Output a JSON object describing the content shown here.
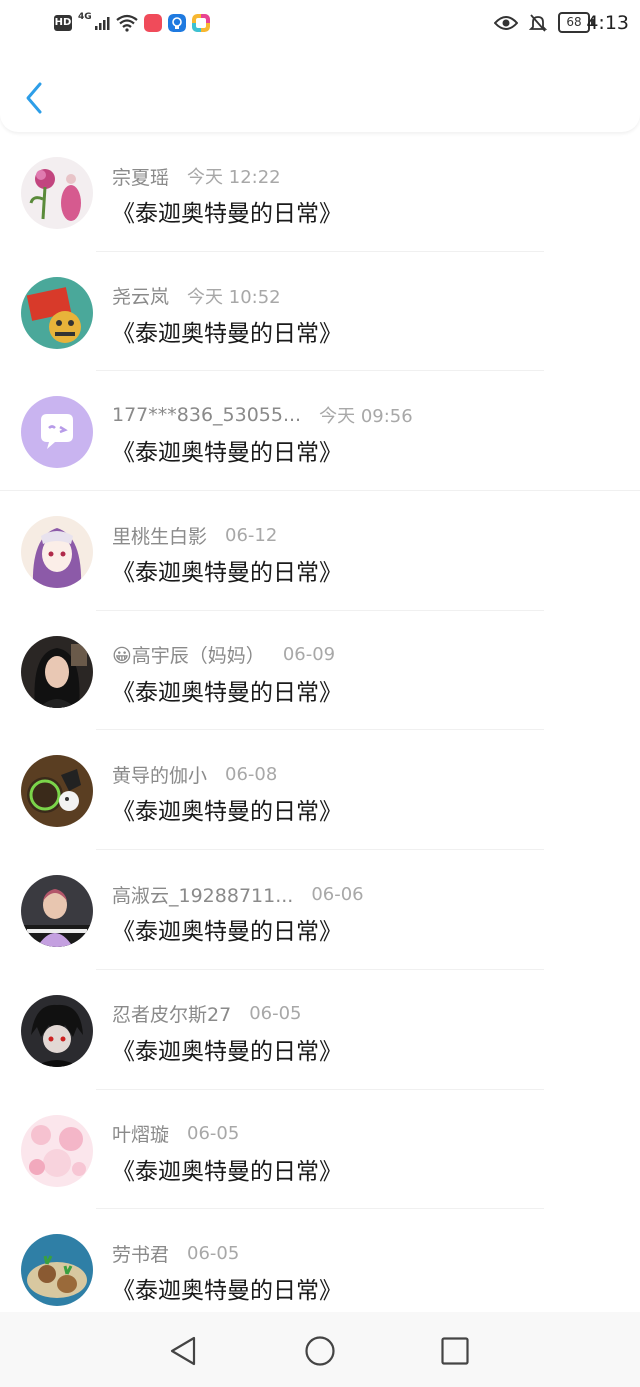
{
  "status_bar": {
    "network_type": "4G",
    "hd_label": "HD",
    "battery": "68",
    "time": "4:13"
  },
  "nav": {
    "back_icon": "chevron-left-icon",
    "accent_color": "#2d9ee8"
  },
  "messages": [
    {
      "sender": "宗夏瑶",
      "time": "今天 12:22",
      "text": "《泰迦奥特曼的日常》"
    },
    {
      "sender": "尧云岚",
      "time": "今天 10:52",
      "text": "《泰迦奥特曼的日常》"
    },
    {
      "sender": "177***836_53055...",
      "time": "今天 09:56",
      "text": "《泰迦奥特曼的日常》"
    },
    {
      "sender": "里桃生白影",
      "time": "06-12",
      "text": "《泰迦奥特曼的日常》"
    },
    {
      "sender": "😀高宇辰（妈妈）",
      "time": "06-09",
      "text": "《泰迦奥特曼的日常》"
    },
    {
      "sender": "黄导的伽小",
      "time": "06-08",
      "text": "《泰迦奥特曼的日常》"
    },
    {
      "sender": "高淑云_19288711...",
      "time": "06-06",
      "text": "《泰迦奥特曼的日常》"
    },
    {
      "sender": "忍者皮尔斯27",
      "time": "06-05",
      "text": "《泰迦奥特曼的日常》"
    },
    {
      "sender": "叶熠璇",
      "time": "06-05",
      "text": "《泰迦奥特曼的日常》"
    },
    {
      "sender": "劳书君",
      "time": "06-05",
      "text": "《泰迦奥特曼的日常》"
    }
  ],
  "system_nav": {
    "back": "triangle-back-icon",
    "home": "circle-home-icon",
    "recents": "square-recents-icon"
  }
}
